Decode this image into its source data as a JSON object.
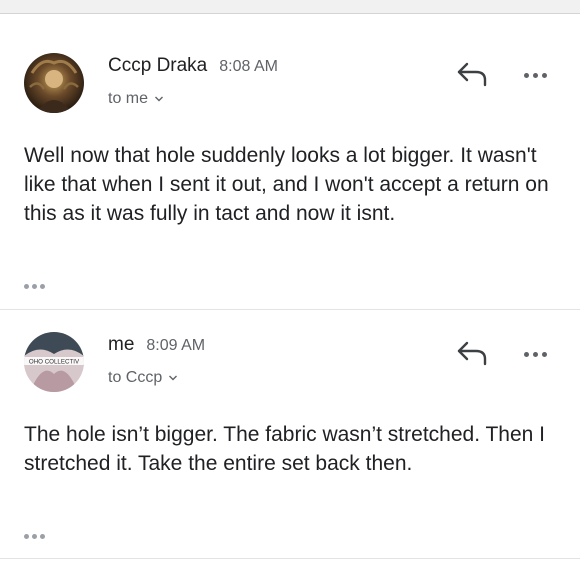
{
  "messages": [
    {
      "sender": "Cccp Draka",
      "time": "8:08 AM",
      "recipient": "to me",
      "body": "Well now that hole suddenly looks a lot bigger. It wasn't like that when I sent it out, and I won't accept a return on this as it was fully in tact and now it isnt."
    },
    {
      "sender": "me",
      "time": "8:09 AM",
      "recipient": "to Cccp",
      "body": "The hole isn’t bigger. The fabric wasn’t stretched. Then I stretched it. Take the entire set back then.",
      "avatar_text": "OHO COLLECTIV"
    }
  ],
  "icons": {
    "reply": "reply-icon",
    "more": "more-options-icon",
    "chevron": "chevron-down-icon",
    "trimmed": "show-trimmed-content-icon"
  },
  "colors": {
    "text": "#202124",
    "secondary": "#5f6368",
    "divider": "#e3e3e3"
  }
}
